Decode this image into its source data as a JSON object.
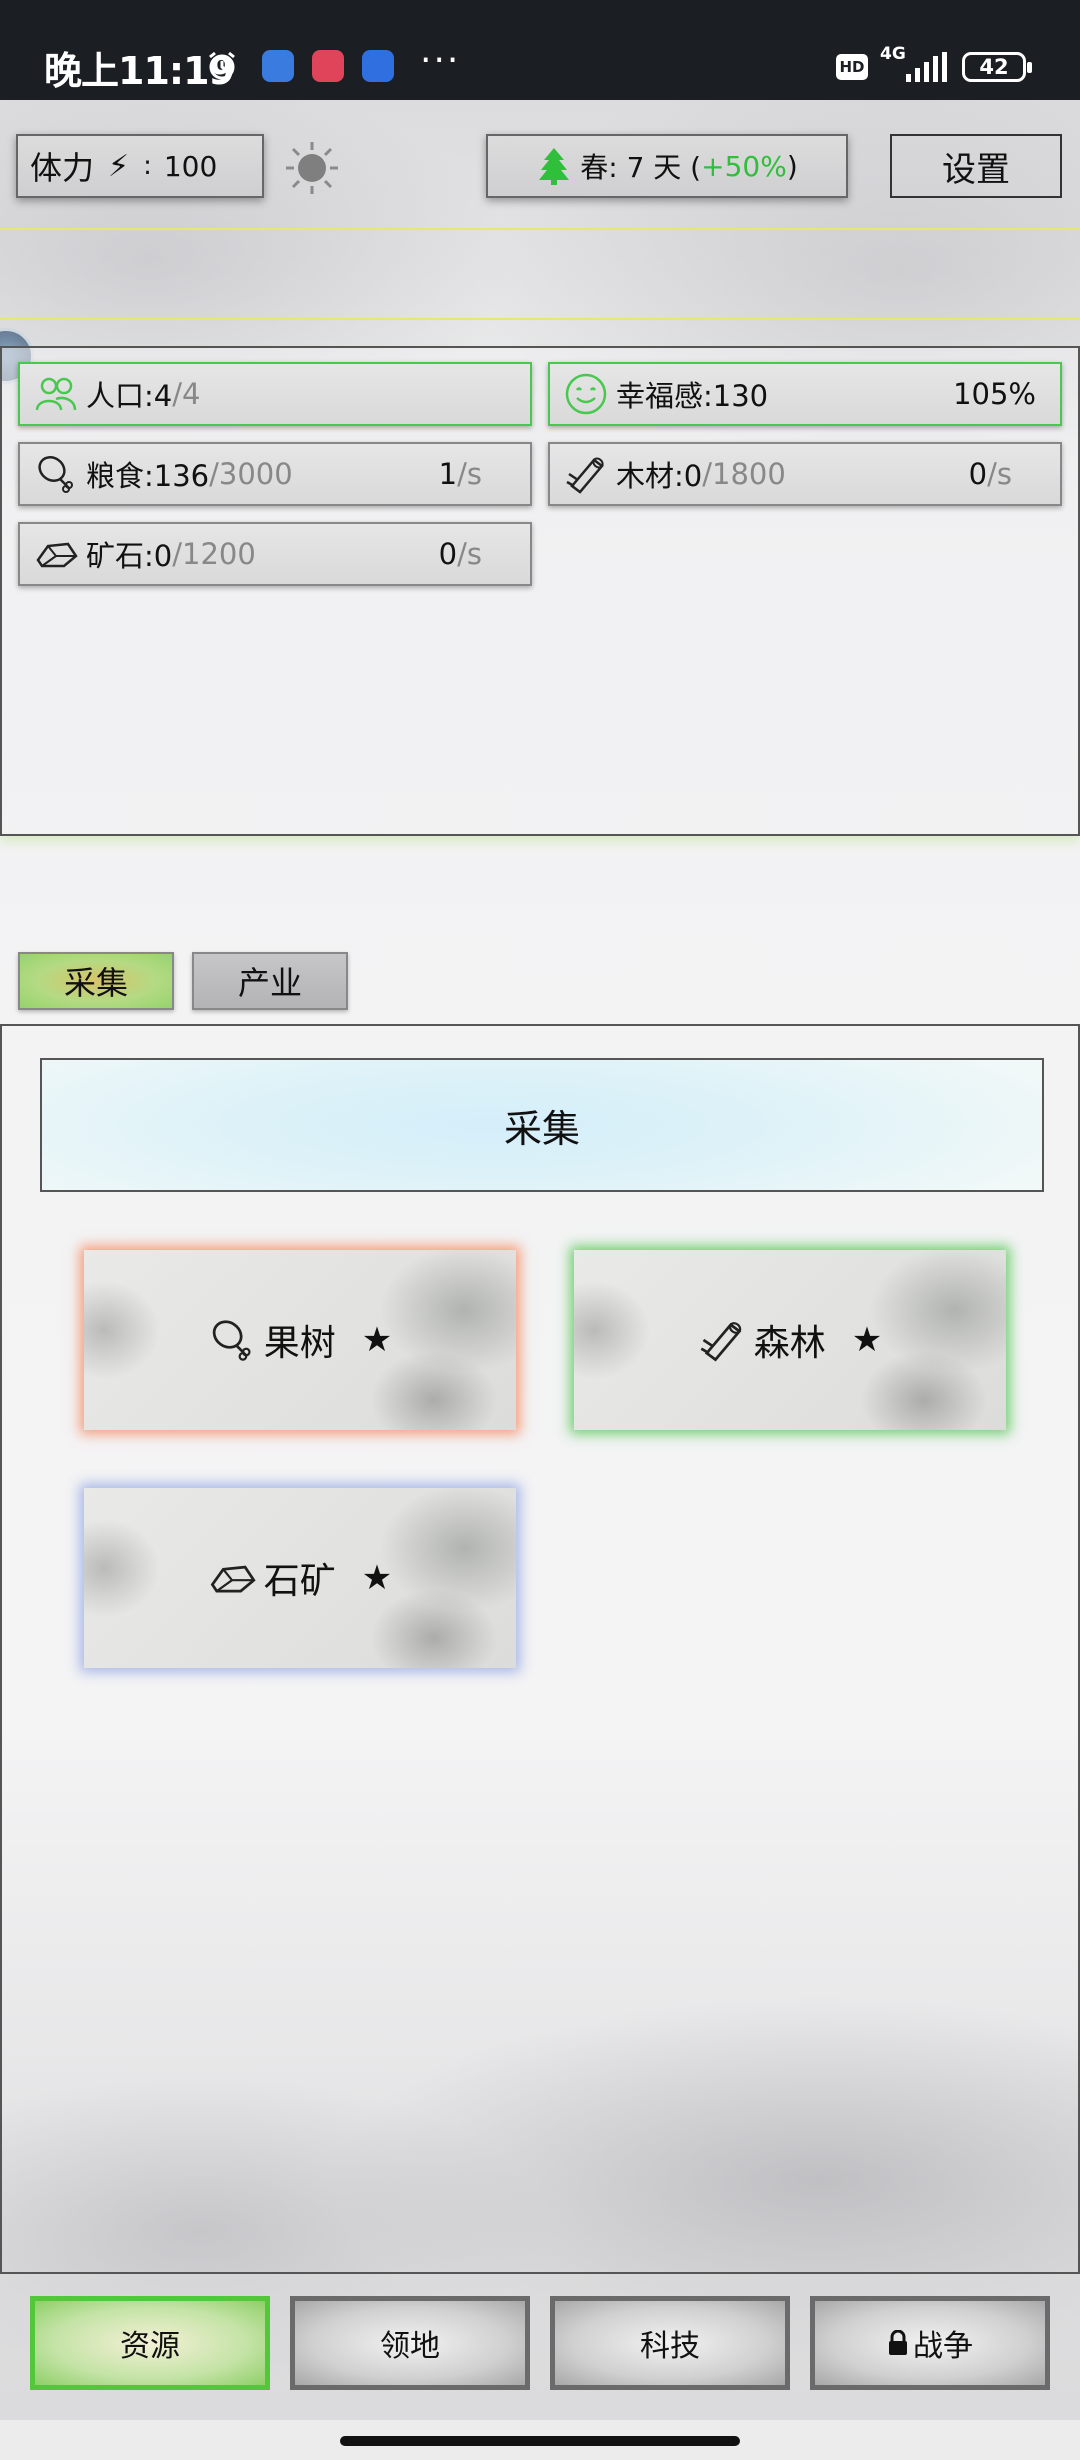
{
  "status_bar": {
    "time": "晚上11:19",
    "more": "···",
    "hd": "HD",
    "network": "4G",
    "battery": "42"
  },
  "top": {
    "stamina_label": "体力",
    "stamina_colon": ":",
    "stamina_value": "100",
    "season_text": "春: 7 天 (",
    "season_bonus": "+50%",
    "season_close": ")",
    "settings_label": "设置"
  },
  "resources": {
    "population": {
      "label": "人口:4",
      "max": "/4"
    },
    "happiness": {
      "label": "幸福感:130",
      "pct": "105%"
    },
    "food": {
      "label": "粮食:136",
      "max": "/3000",
      "rate": "1",
      "unit": "/s"
    },
    "wood": {
      "label": "木材:0",
      "max": "/1800",
      "rate": "0",
      "unit": "/s"
    },
    "ore": {
      "label": "矿石:0",
      "max": "/1200",
      "rate": "0",
      "unit": "/s"
    }
  },
  "tabs": [
    {
      "label": "采集",
      "active": true
    },
    {
      "label": "产业",
      "active": false
    }
  ],
  "main": {
    "title": "采集",
    "cards": [
      {
        "label": "果树",
        "star": "★",
        "icon": "meat-icon"
      },
      {
        "label": "森林",
        "star": "★",
        "icon": "log-icon"
      },
      {
        "label": "石矿",
        "star": "★",
        "icon": "stone-icon"
      }
    ]
  },
  "nav": [
    {
      "label": "资源",
      "active": true
    },
    {
      "label": "领地",
      "active": false
    },
    {
      "label": "科技",
      "active": false
    },
    {
      "label": "战争",
      "active": false,
      "locked": true
    }
  ],
  "colors": {
    "accent_green": "#48c84e",
    "bonus_green": "#2fbf3a",
    "orange_glow": "#f48c64",
    "blue_glow": "#96aae6"
  }
}
